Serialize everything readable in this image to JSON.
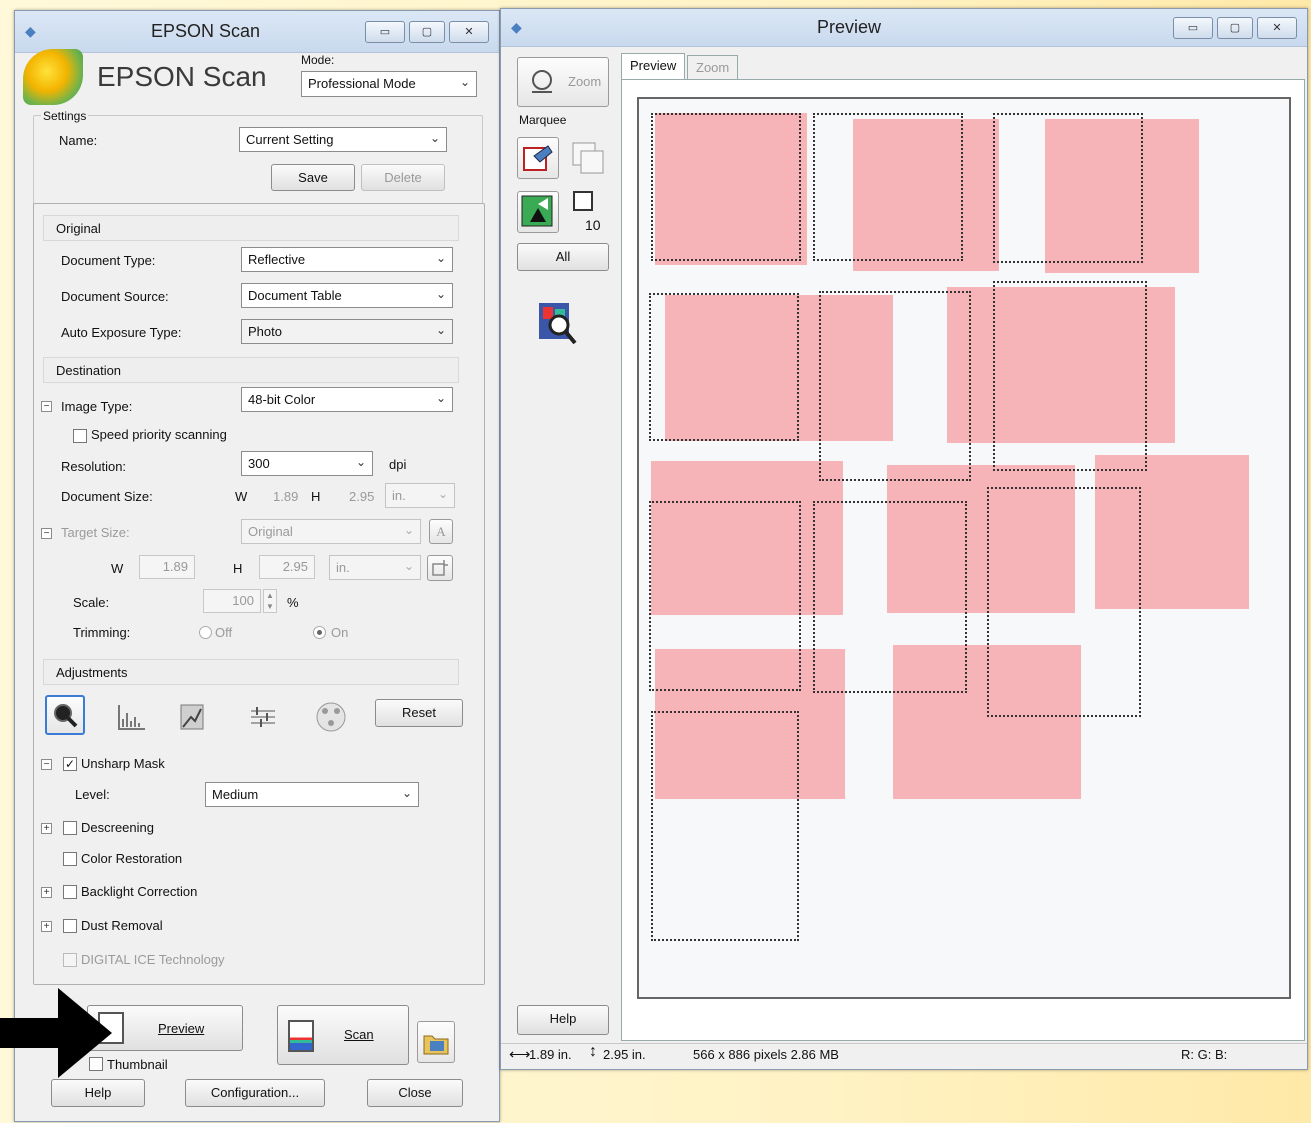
{
  "scan_window": {
    "title": "EPSON Scan",
    "logo_text": "EPSON Scan",
    "mode_label": "Mode:",
    "mode_value": "Professional Mode",
    "settings": {
      "group_label": "Settings",
      "name_label": "Name:",
      "name_value": "Current Setting",
      "save_label": "Save",
      "delete_label": "Delete"
    },
    "original": {
      "header": "Original",
      "doc_type_label": "Document Type:",
      "doc_type_value": "Reflective",
      "doc_source_label": "Document Source:",
      "doc_source_value": "Document Table",
      "auto_exposure_label": "Auto Exposure Type:",
      "auto_exposure_value": "Photo"
    },
    "destination": {
      "header": "Destination",
      "image_type_label": "Image Type:",
      "image_type_value": "48-bit Color",
      "speed_priority_label": "Speed priority scanning",
      "resolution_label": "Resolution:",
      "resolution_value": "300",
      "dpi_label": "dpi",
      "doc_size_label": "Document Size:",
      "w_label": "W",
      "w_value": "1.89",
      "h_label": "H",
      "h_value": "2.95",
      "unit": "in.",
      "target_size_label": "Target Size:",
      "target_size_value": "Original",
      "target_w_label": "W",
      "target_w_value": "1.89",
      "target_h_label": "H",
      "target_h_value": "2.95",
      "target_unit": "in.",
      "scale_label": "Scale:",
      "scale_value": "100",
      "scale_unit": "%",
      "trimming_label": "Trimming:",
      "trimming_off": "Off",
      "trimming_on": "On"
    },
    "adjustments": {
      "header": "Adjustments",
      "reset_label": "Reset",
      "unsharp_label": "Unsharp Mask",
      "unsharp_checked": "✓",
      "level_label": "Level:",
      "level_value": "Medium",
      "descreening_label": "Descreening",
      "color_restoration_label": "Color Restoration",
      "backlight_label": "Backlight Correction",
      "dust_label": "Dust Removal",
      "digital_ice_label": "DIGITAL ICE Technology"
    },
    "bottom": {
      "preview_label": "Preview",
      "scan_label": "Scan",
      "thumbnail_label": "Thumbnail",
      "help_label": "Help",
      "configuration_label": "Configuration...",
      "close_label": "Close"
    }
  },
  "preview_window": {
    "title": "Preview",
    "zoom_label": "Zoom",
    "marquee_label": "Marquee",
    "marquee_count": "10",
    "all_label": "All",
    "help_label": "Help",
    "tabs": [
      "Preview",
      "Zoom"
    ],
    "status": {
      "width": "1.89 in.",
      "height": "2.95 in.",
      "pixels": "566 x 886 pixels 2.86 MB",
      "rgb": "R: G: B:"
    }
  },
  "icons": {
    "caption": [
      "minimize-icon",
      "maximize-icon",
      "close-icon"
    ],
    "adjust": [
      "auto-exposure-icon",
      "histogram-icon",
      "tone-correction-icon",
      "image-adjust-icon",
      "color-palette-icon"
    ]
  }
}
